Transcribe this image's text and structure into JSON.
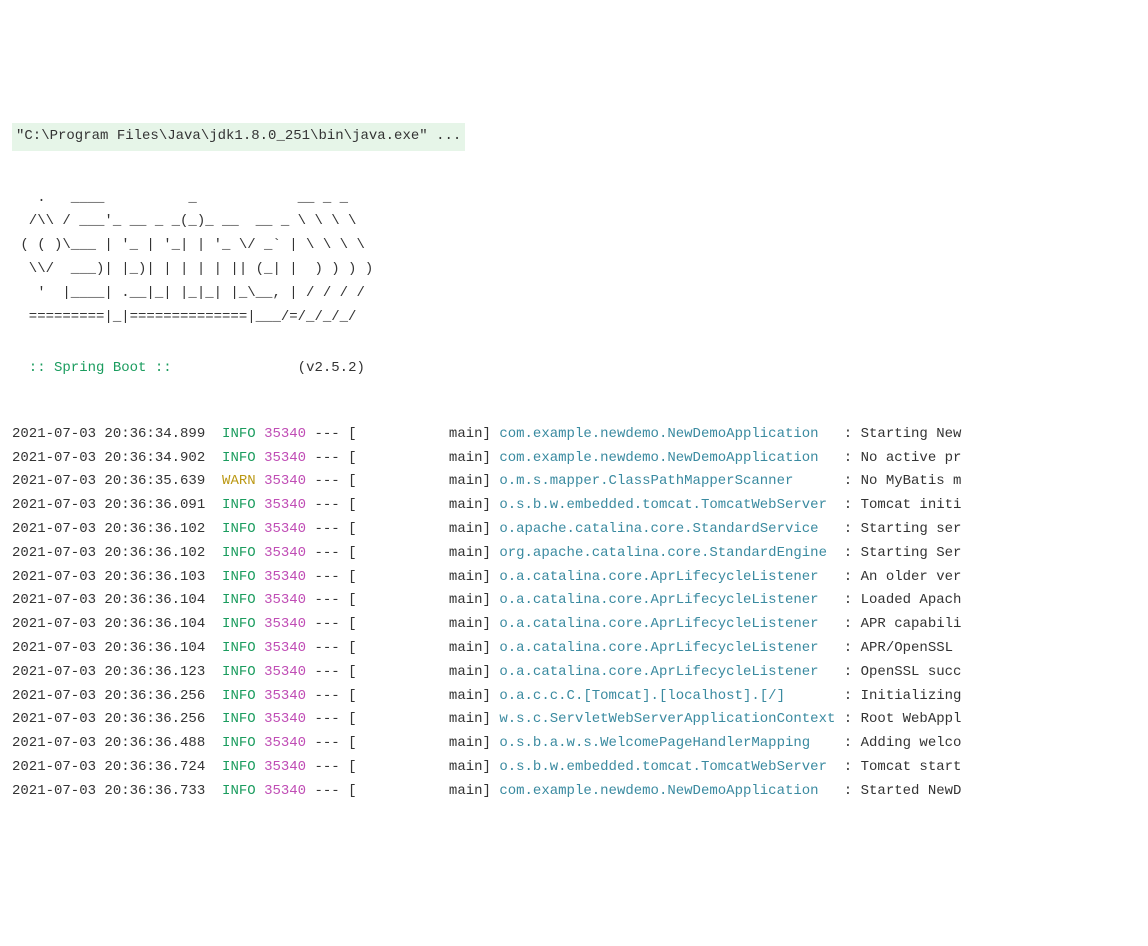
{
  "header": {
    "command": "\"C:\\Program Files\\Java\\jdk1.8.0_251\\bin\\java.exe\" ..."
  },
  "banner": {
    "line1": "   .   ____          _            __ _ _",
    "line2": "  /\\\\ / ___'_ __ _ _(_)_ __  __ _ \\ \\ \\ \\",
    "line3": " ( ( )\\___ | '_ | '_| | '_ \\/ _` | \\ \\ \\ \\",
    "line4": "  \\\\/  ___)| |_)| | | | | || (_| |  ) ) ) )",
    "line5": "   '  |____| .__|_| |_|_| |_\\__, | / / / /",
    "line6": "  =========|_|==============|___/=/_/_/_/",
    "spring_label": "  :: Spring Boot ::",
    "version_padding": "               ",
    "version": "(v2.5.2)"
  },
  "logs": [
    {
      "timestamp": "2021-07-03 20:36:34.899",
      "level": "INFO",
      "pid": "35340",
      "dash": " --- [",
      "thread": "           main] ",
      "logger": "com.example.newdemo.NewDemoApplication  ",
      "sep": " : ",
      "message": "Starting New"
    },
    {
      "timestamp": "2021-07-03 20:36:34.902",
      "level": "INFO",
      "pid": "35340",
      "dash": " --- [",
      "thread": "           main] ",
      "logger": "com.example.newdemo.NewDemoApplication  ",
      "sep": " : ",
      "message": "No active pr"
    },
    {
      "timestamp": "2021-07-03 20:36:35.639",
      "level": "WARN",
      "pid": "35340",
      "dash": " --- [",
      "thread": "           main] ",
      "logger": "o.m.s.mapper.ClassPathMapperScanner     ",
      "sep": " : ",
      "message": "No MyBatis m"
    },
    {
      "timestamp": "2021-07-03 20:36:36.091",
      "level": "INFO",
      "pid": "35340",
      "dash": " --- [",
      "thread": "           main] ",
      "logger": "o.s.b.w.embedded.tomcat.TomcatWebServer ",
      "sep": " : ",
      "message": "Tomcat initi"
    },
    {
      "timestamp": "2021-07-03 20:36:36.102",
      "level": "INFO",
      "pid": "35340",
      "dash": " --- [",
      "thread": "           main] ",
      "logger": "o.apache.catalina.core.StandardService  ",
      "sep": " : ",
      "message": "Starting ser"
    },
    {
      "timestamp": "2021-07-03 20:36:36.102",
      "level": "INFO",
      "pid": "35340",
      "dash": " --- [",
      "thread": "           main] ",
      "logger": "org.apache.catalina.core.StandardEngine ",
      "sep": " : ",
      "message": "Starting Ser"
    },
    {
      "timestamp": "2021-07-03 20:36:36.103",
      "level": "INFO",
      "pid": "35340",
      "dash": " --- [",
      "thread": "           main] ",
      "logger": "o.a.catalina.core.AprLifecycleListener  ",
      "sep": " : ",
      "message": "An older ver"
    },
    {
      "timestamp": "2021-07-03 20:36:36.104",
      "level": "INFO",
      "pid": "35340",
      "dash": " --- [",
      "thread": "           main] ",
      "logger": "o.a.catalina.core.AprLifecycleListener  ",
      "sep": " : ",
      "message": "Loaded Apach"
    },
    {
      "timestamp": "2021-07-03 20:36:36.104",
      "level": "INFO",
      "pid": "35340",
      "dash": " --- [",
      "thread": "           main] ",
      "logger": "o.a.catalina.core.AprLifecycleListener  ",
      "sep": " : ",
      "message": "APR capabili"
    },
    {
      "timestamp": "2021-07-03 20:36:36.104",
      "level": "INFO",
      "pid": "35340",
      "dash": " --- [",
      "thread": "           main] ",
      "logger": "o.a.catalina.core.AprLifecycleListener  ",
      "sep": " : ",
      "message": "APR/OpenSSL "
    },
    {
      "timestamp": "2021-07-03 20:36:36.123",
      "level": "INFO",
      "pid": "35340",
      "dash": " --- [",
      "thread": "           main] ",
      "logger": "o.a.catalina.core.AprLifecycleListener  ",
      "sep": " : ",
      "message": "OpenSSL succ"
    },
    {
      "timestamp": "2021-07-03 20:36:36.256",
      "level": "INFO",
      "pid": "35340",
      "dash": " --- [",
      "thread": "           main] ",
      "logger": "o.a.c.c.C.[Tomcat].[localhost].[/]      ",
      "sep": " : ",
      "message": "Initializing"
    },
    {
      "timestamp": "2021-07-03 20:36:36.256",
      "level": "INFO",
      "pid": "35340",
      "dash": " --- [",
      "thread": "           main] ",
      "logger": "w.s.c.ServletWebServerApplicationContext",
      "sep": " : ",
      "message": "Root WebAppl"
    },
    {
      "timestamp": "2021-07-03 20:36:36.488",
      "level": "INFO",
      "pid": "35340",
      "dash": " --- [",
      "thread": "           main] ",
      "logger": "o.s.b.a.w.s.WelcomePageHandlerMapping   ",
      "sep": " : ",
      "message": "Adding welco"
    },
    {
      "timestamp": "2021-07-03 20:36:36.724",
      "level": "INFO",
      "pid": "35340",
      "dash": " --- [",
      "thread": "           main] ",
      "logger": "o.s.b.w.embedded.tomcat.TomcatWebServer ",
      "sep": " : ",
      "message": "Tomcat start"
    },
    {
      "timestamp": "2021-07-03 20:36:36.733",
      "level": "INFO",
      "pid": "35340",
      "dash": " --- [",
      "thread": "           main] ",
      "logger": "com.example.newdemo.NewDemoApplication  ",
      "sep": " : ",
      "message": "Started NewD"
    }
  ]
}
